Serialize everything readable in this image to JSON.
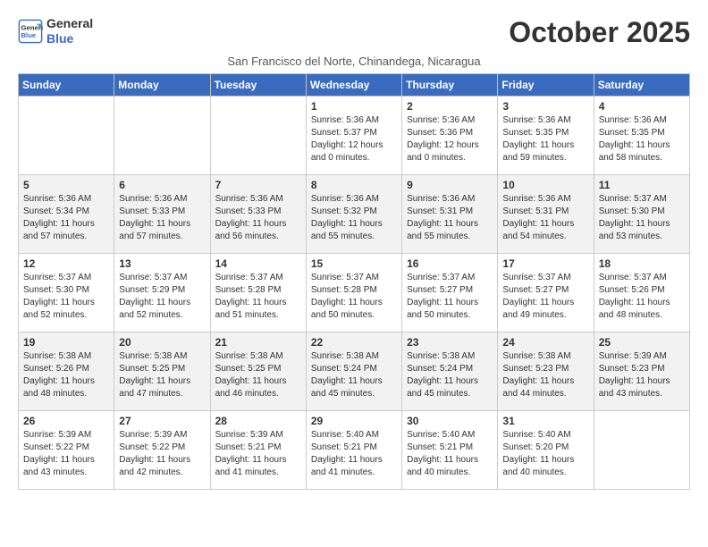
{
  "logo": {
    "line1": "General",
    "line2": "Blue"
  },
  "title": "October 2025",
  "location": "San Francisco del Norte, Chinandega, Nicaragua",
  "header_accent": "#3a6bbf",
  "days_of_week": [
    "Sunday",
    "Monday",
    "Tuesday",
    "Wednesday",
    "Thursday",
    "Friday",
    "Saturday"
  ],
  "weeks": [
    [
      {
        "day": "",
        "sunrise": "",
        "sunset": "",
        "daylight": ""
      },
      {
        "day": "",
        "sunrise": "",
        "sunset": "",
        "daylight": ""
      },
      {
        "day": "",
        "sunrise": "",
        "sunset": "",
        "daylight": ""
      },
      {
        "day": "1",
        "sunrise": "Sunrise: 5:36 AM",
        "sunset": "Sunset: 5:37 PM",
        "daylight": "Daylight: 12 hours and 0 minutes."
      },
      {
        "day": "2",
        "sunrise": "Sunrise: 5:36 AM",
        "sunset": "Sunset: 5:36 PM",
        "daylight": "Daylight: 12 hours and 0 minutes."
      },
      {
        "day": "3",
        "sunrise": "Sunrise: 5:36 AM",
        "sunset": "Sunset: 5:35 PM",
        "daylight": "Daylight: 11 hours and 59 minutes."
      },
      {
        "day": "4",
        "sunrise": "Sunrise: 5:36 AM",
        "sunset": "Sunset: 5:35 PM",
        "daylight": "Daylight: 11 hours and 58 minutes."
      }
    ],
    [
      {
        "day": "5",
        "sunrise": "Sunrise: 5:36 AM",
        "sunset": "Sunset: 5:34 PM",
        "daylight": "Daylight: 11 hours and 57 minutes."
      },
      {
        "day": "6",
        "sunrise": "Sunrise: 5:36 AM",
        "sunset": "Sunset: 5:33 PM",
        "daylight": "Daylight: 11 hours and 57 minutes."
      },
      {
        "day": "7",
        "sunrise": "Sunrise: 5:36 AM",
        "sunset": "Sunset: 5:33 PM",
        "daylight": "Daylight: 11 hours and 56 minutes."
      },
      {
        "day": "8",
        "sunrise": "Sunrise: 5:36 AM",
        "sunset": "Sunset: 5:32 PM",
        "daylight": "Daylight: 11 hours and 55 minutes."
      },
      {
        "day": "9",
        "sunrise": "Sunrise: 5:36 AM",
        "sunset": "Sunset: 5:31 PM",
        "daylight": "Daylight: 11 hours and 55 minutes."
      },
      {
        "day": "10",
        "sunrise": "Sunrise: 5:36 AM",
        "sunset": "Sunset: 5:31 PM",
        "daylight": "Daylight: 11 hours and 54 minutes."
      },
      {
        "day": "11",
        "sunrise": "Sunrise: 5:37 AM",
        "sunset": "Sunset: 5:30 PM",
        "daylight": "Daylight: 11 hours and 53 minutes."
      }
    ],
    [
      {
        "day": "12",
        "sunrise": "Sunrise: 5:37 AM",
        "sunset": "Sunset: 5:30 PM",
        "daylight": "Daylight: 11 hours and 52 minutes."
      },
      {
        "day": "13",
        "sunrise": "Sunrise: 5:37 AM",
        "sunset": "Sunset: 5:29 PM",
        "daylight": "Daylight: 11 hours and 52 minutes."
      },
      {
        "day": "14",
        "sunrise": "Sunrise: 5:37 AM",
        "sunset": "Sunset: 5:28 PM",
        "daylight": "Daylight: 11 hours and 51 minutes."
      },
      {
        "day": "15",
        "sunrise": "Sunrise: 5:37 AM",
        "sunset": "Sunset: 5:28 PM",
        "daylight": "Daylight: 11 hours and 50 minutes."
      },
      {
        "day": "16",
        "sunrise": "Sunrise: 5:37 AM",
        "sunset": "Sunset: 5:27 PM",
        "daylight": "Daylight: 11 hours and 50 minutes."
      },
      {
        "day": "17",
        "sunrise": "Sunrise: 5:37 AM",
        "sunset": "Sunset: 5:27 PM",
        "daylight": "Daylight: 11 hours and 49 minutes."
      },
      {
        "day": "18",
        "sunrise": "Sunrise: 5:37 AM",
        "sunset": "Sunset: 5:26 PM",
        "daylight": "Daylight: 11 hours and 48 minutes."
      }
    ],
    [
      {
        "day": "19",
        "sunrise": "Sunrise: 5:38 AM",
        "sunset": "Sunset: 5:26 PM",
        "daylight": "Daylight: 11 hours and 48 minutes."
      },
      {
        "day": "20",
        "sunrise": "Sunrise: 5:38 AM",
        "sunset": "Sunset: 5:25 PM",
        "daylight": "Daylight: 11 hours and 47 minutes."
      },
      {
        "day": "21",
        "sunrise": "Sunrise: 5:38 AM",
        "sunset": "Sunset: 5:25 PM",
        "daylight": "Daylight: 11 hours and 46 minutes."
      },
      {
        "day": "22",
        "sunrise": "Sunrise: 5:38 AM",
        "sunset": "Sunset: 5:24 PM",
        "daylight": "Daylight: 11 hours and 45 minutes."
      },
      {
        "day": "23",
        "sunrise": "Sunrise: 5:38 AM",
        "sunset": "Sunset: 5:24 PM",
        "daylight": "Daylight: 11 hours and 45 minutes."
      },
      {
        "day": "24",
        "sunrise": "Sunrise: 5:38 AM",
        "sunset": "Sunset: 5:23 PM",
        "daylight": "Daylight: 11 hours and 44 minutes."
      },
      {
        "day": "25",
        "sunrise": "Sunrise: 5:39 AM",
        "sunset": "Sunset: 5:23 PM",
        "daylight": "Daylight: 11 hours and 43 minutes."
      }
    ],
    [
      {
        "day": "26",
        "sunrise": "Sunrise: 5:39 AM",
        "sunset": "Sunset: 5:22 PM",
        "daylight": "Daylight: 11 hours and 43 minutes."
      },
      {
        "day": "27",
        "sunrise": "Sunrise: 5:39 AM",
        "sunset": "Sunset: 5:22 PM",
        "daylight": "Daylight: 11 hours and 42 minutes."
      },
      {
        "day": "28",
        "sunrise": "Sunrise: 5:39 AM",
        "sunset": "Sunset: 5:21 PM",
        "daylight": "Daylight: 11 hours and 41 minutes."
      },
      {
        "day": "29",
        "sunrise": "Sunrise: 5:40 AM",
        "sunset": "Sunset: 5:21 PM",
        "daylight": "Daylight: 11 hours and 41 minutes."
      },
      {
        "day": "30",
        "sunrise": "Sunrise: 5:40 AM",
        "sunset": "Sunset: 5:21 PM",
        "daylight": "Daylight: 11 hours and 40 minutes."
      },
      {
        "day": "31",
        "sunrise": "Sunrise: 5:40 AM",
        "sunset": "Sunset: 5:20 PM",
        "daylight": "Daylight: 11 hours and 40 minutes."
      },
      {
        "day": "",
        "sunrise": "",
        "sunset": "",
        "daylight": ""
      }
    ]
  ]
}
